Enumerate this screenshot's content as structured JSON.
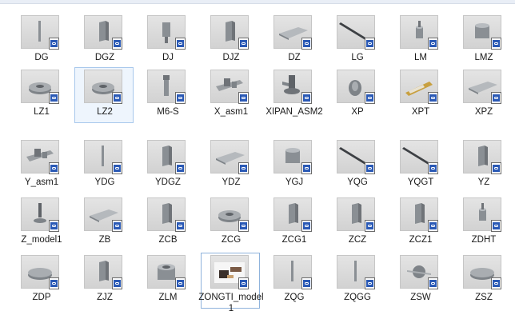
{
  "files": [
    {
      "name": "DG",
      "icon": "rod-icon"
    },
    {
      "name": "DGZ",
      "icon": "bracket-icon"
    },
    {
      "name": "DJ",
      "icon": "post-icon"
    },
    {
      "name": "DJZ",
      "icon": "bracket-icon"
    },
    {
      "name": "DZ",
      "icon": "plate-icon"
    },
    {
      "name": "LG",
      "icon": "bar-icon"
    },
    {
      "name": "LM",
      "icon": "pin-icon"
    },
    {
      "name": "LMZ",
      "icon": "block-icon"
    },
    {
      "name": "LZ1",
      "icon": "washer-icon"
    },
    {
      "name": "LZ2",
      "icon": "washer-icon"
    },
    {
      "name": "M6-S",
      "icon": "bolt-icon"
    },
    {
      "name": "X_asm1",
      "icon": "assembly-icon"
    },
    {
      "name": "XIPAN_ASM2",
      "icon": "suction-assembly-icon"
    },
    {
      "name": "XP",
      "icon": "cup-icon"
    },
    {
      "name": "XPT",
      "icon": "cylinder-icon"
    },
    {
      "name": "XPZ",
      "icon": "plate-icon"
    },
    {
      "name": "Y_asm1",
      "icon": "assembly-icon"
    },
    {
      "name": "YDG",
      "icon": "rod-icon"
    },
    {
      "name": "YDGZ",
      "icon": "bracket-icon"
    },
    {
      "name": "YDZ",
      "icon": "plate-icon"
    },
    {
      "name": "YGJ",
      "icon": "block-icon"
    },
    {
      "name": "YQG",
      "icon": "bar-icon"
    },
    {
      "name": "YQGT",
      "icon": "bar-icon"
    },
    {
      "name": "YZ",
      "icon": "bracket-icon"
    },
    {
      "name": "Z_model1",
      "icon": "stand-icon"
    },
    {
      "name": "ZB",
      "icon": "plate-icon"
    },
    {
      "name": "ZCB",
      "icon": "bracket-icon"
    },
    {
      "name": "ZCG",
      "icon": "washer-icon"
    },
    {
      "name": "ZCG1",
      "icon": "bracket-icon"
    },
    {
      "name": "ZCZ",
      "icon": "bracket-icon"
    },
    {
      "name": "ZCZ1",
      "icon": "bracket-icon"
    },
    {
      "name": "ZDHT",
      "icon": "pin-icon"
    },
    {
      "name": "ZDP",
      "icon": "disc-icon"
    },
    {
      "name": "ZJZ",
      "icon": "bracket-icon"
    },
    {
      "name": "ZLM",
      "icon": "nut-icon"
    },
    {
      "name": "ZONGTI_model1",
      "icon": "model-photo-icon"
    },
    {
      "name": "ZQG",
      "icon": "rod-icon"
    },
    {
      "name": "ZQGG",
      "icon": "rod-icon"
    },
    {
      "name": "ZSW",
      "icon": "cross-icon"
    },
    {
      "name": "ZSZ",
      "icon": "disc-icon"
    }
  ],
  "selected": "LZ2",
  "focused": "ZONGTI_model1",
  "colors": {
    "thumbnail_bg": "#d6d6d6",
    "part_gray": "#8a8f94",
    "selection_border": "#a8c8ec",
    "badge_blue": "#2a59b5"
  }
}
